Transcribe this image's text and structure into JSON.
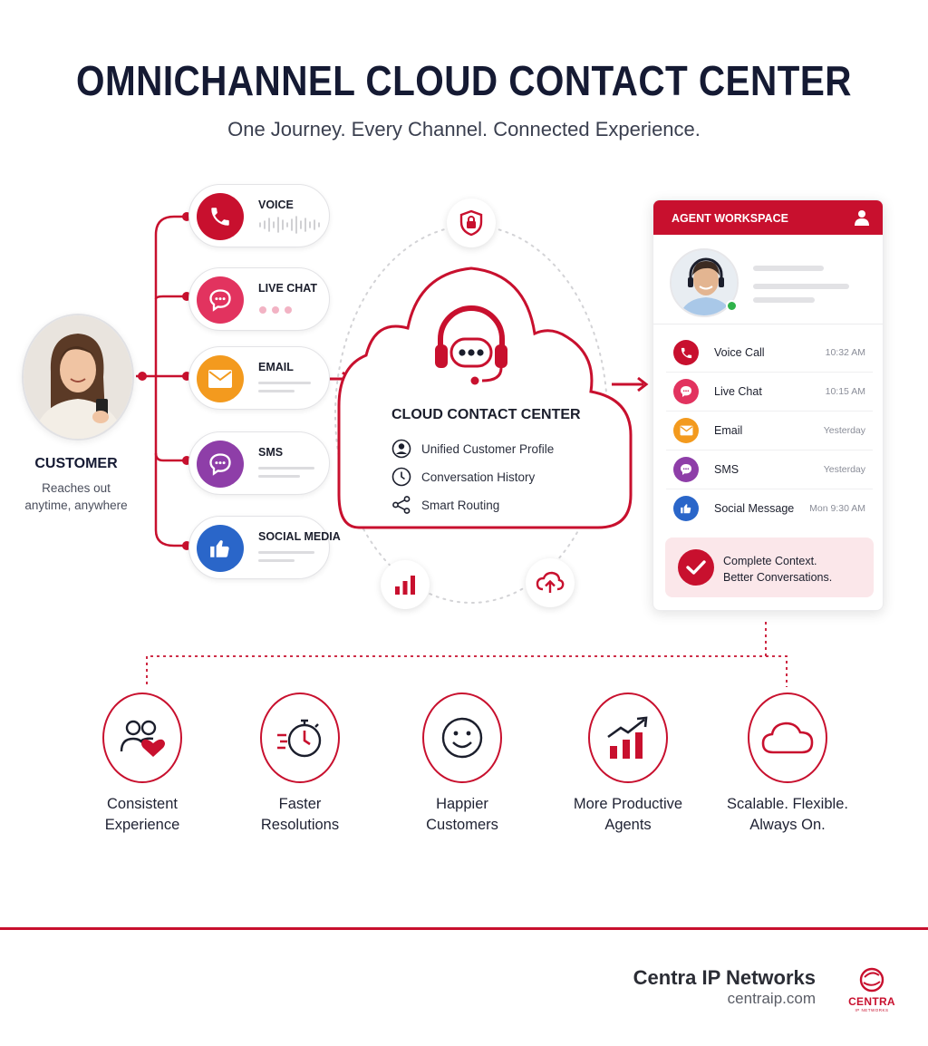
{
  "header": {
    "title": "OMNICHANNEL CLOUD CONTACT CENTER",
    "subtitle": "One Journey. Every Channel. Connected Experience."
  },
  "customer": {
    "title": "CUSTOMER",
    "subtitle_line1": "Reaches out",
    "subtitle_line2": "anytime, anywhere"
  },
  "channels": [
    {
      "label": "VOICE",
      "icon": "phone-icon",
      "color": "#c8102e"
    },
    {
      "label": "LIVE CHAT",
      "icon": "chat-bubble-icon",
      "color": "#e2335f"
    },
    {
      "label": "EMAIL",
      "icon": "envelope-icon",
      "color": "#f39a1e"
    },
    {
      "label": "SMS",
      "icon": "chat-bubble-icon",
      "color": "#8e3ea8"
    },
    {
      "label": "SOCIAL MEDIA",
      "icon": "thumbs-up-icon",
      "color": "#2a66c9"
    }
  ],
  "hub": {
    "title": "CLOUD  CONTACT CENTER",
    "features": [
      {
        "label": "Unified Customer Profile",
        "icon": "user-circle-icon"
      },
      {
        "label": "Conversation History",
        "icon": "clock-icon"
      },
      {
        "label": "Smart Routing",
        "icon": "share-nodes-icon"
      }
    ],
    "orbit_icons": [
      "shield-lock-icon",
      "bar-chart-icon",
      "cloud-upload-icon"
    ],
    "accent": "#c8102e"
  },
  "agent": {
    "header": "AGENT WORKSPACE",
    "rows": [
      {
        "label": "Voice Call",
        "time": "10:32 AM",
        "color": "#c8102e",
        "icon": "phone-icon"
      },
      {
        "label": "Live Chat",
        "time": "10:15 AM",
        "color": "#e2335f",
        "icon": "chat-bubble-icon"
      },
      {
        "label": "Email",
        "time": "Yesterday",
        "color": "#f39a1e",
        "icon": "envelope-icon"
      },
      {
        "label": "SMS",
        "time": "Yesterday",
        "color": "#8e3ea8",
        "icon": "chat-bubble-icon"
      },
      {
        "label": "Social Message",
        "time": "Mon 9:30 AM",
        "color": "#2a66c9",
        "icon": "thumbs-up-icon"
      }
    ],
    "context_line1": "Complete Context.",
    "context_line2": "Better Conversations."
  },
  "benefits": [
    {
      "line1": "Consistent",
      "line2": "Experience",
      "icon": "users-heart-icon"
    },
    {
      "line1": "Faster",
      "line2": "Resolutions",
      "icon": "stopwatch-icon"
    },
    {
      "line1": "Happier",
      "line2": "Customers",
      "icon": "smiley-icon"
    },
    {
      "line1": "More Productive",
      "line2": "Agents",
      "icon": "growth-chart-icon"
    },
    {
      "line1": "Scalable. Flexible.",
      "line2": "Always On.",
      "icon": "cloud-icon"
    }
  ],
  "footer": {
    "brand": "Centra IP Networks",
    "url": "centraip.com",
    "logo_text": "CENTRA",
    "logo_subtext": "IP NETWORKS"
  }
}
